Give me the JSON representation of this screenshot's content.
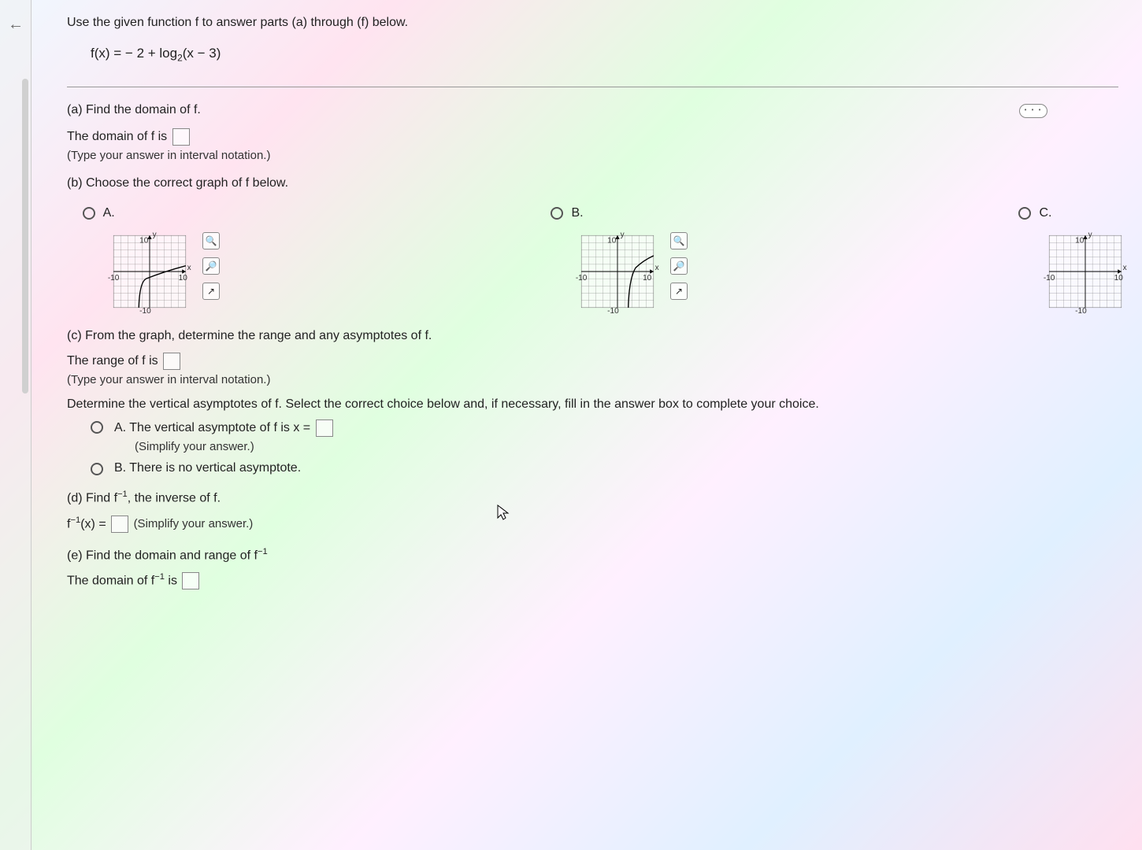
{
  "intro": "Use the given function f to answer parts (a) through (f) below.",
  "formula_prefix": "f(x) = − 2 + log",
  "formula_sub": "2",
  "formula_suffix": "(x − 3)",
  "more_dots": "• • •",
  "partA": {
    "label": "(a) Find the domain of f.",
    "prompt_pre": "The domain of f is ",
    "hint": "(Type your answer in interval notation.)"
  },
  "partB": {
    "label": "(b) Choose the correct graph of f below.",
    "optA": "A.",
    "optB": "B.",
    "optC": "C.",
    "axis": {
      "y": "y",
      "x": "x",
      "p10": "10",
      "n10": "-10",
      "nn10": "-10"
    }
  },
  "partC": {
    "label": "(c) From the graph, determine the range and any asymptotes of f.",
    "range_pre": "The range of f is ",
    "hint": "(Type your answer in interval notation.)",
    "asym": "Determine the vertical asymptotes of f. Select the correct choice below and, if necessary, fill in the answer box to complete your choice.",
    "optA_pre": "A.   The vertical asymptote of f is x = ",
    "optA_hint": "(Simplify your answer.)",
    "optB": "B.   There is no vertical asymptote."
  },
  "partD": {
    "label_pre": "(d) Find f",
    "label_sup": "−1",
    "label_post": ", the inverse of f.",
    "eq_pre": "f",
    "eq_sup": "−1",
    "eq_mid": "(x) = ",
    "eq_hint": " (Simplify your answer.)"
  },
  "partE": {
    "label_pre": "(e) Find the domain and range of f",
    "label_sup": "−1",
    "domain_pre": "The domain of f",
    "domain_sup": "−1",
    "domain_post": " is "
  }
}
